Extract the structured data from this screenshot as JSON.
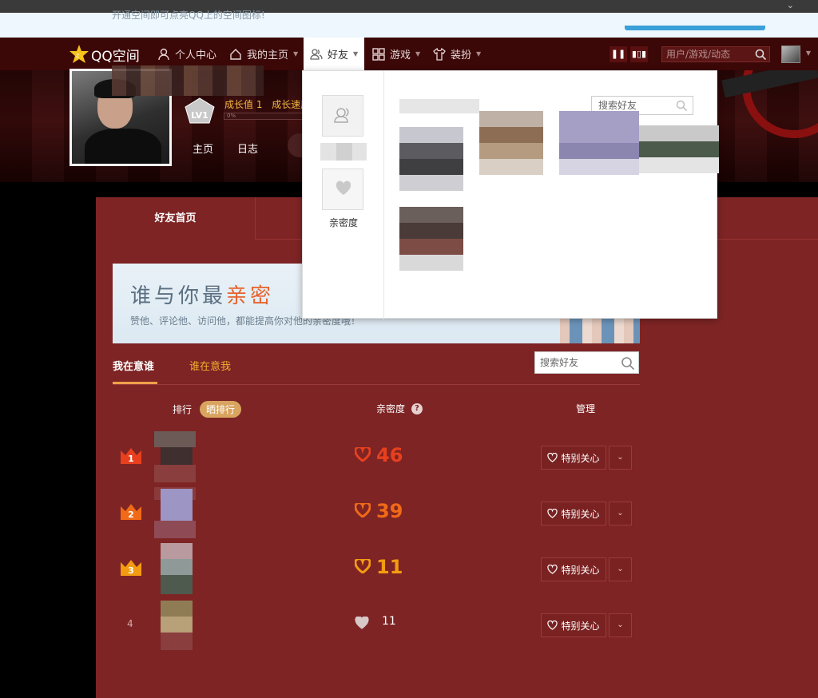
{
  "notice": {
    "text": "开通空间即可点亮QQ上的空间图标!"
  },
  "nav": {
    "logo": "QQ空间",
    "items": [
      {
        "label": "个人中心"
      },
      {
        "label": "我的主页"
      },
      {
        "label": "好友"
      },
      {
        "label": "游戏"
      },
      {
        "label": "装扮"
      }
    ],
    "search_placeholder": "用户/游戏/动态"
  },
  "profile": {
    "level": "LV1",
    "growth_value": "成长值 1",
    "growth_speed": "成长速度",
    "progress": "0%",
    "tabs": [
      "主页",
      "日志"
    ]
  },
  "panel": {
    "home_tab": "好友首页",
    "banner_title_plain": "谁与你最",
    "banner_title_accent": "亲密",
    "banner_subtitle": "赞他、评论他、访问他，都能提高你对他的亲密度哦！",
    "subtabs": [
      "我在意谁",
      "谁在意我"
    ],
    "search_placeholder": "搜索好友",
    "columns": {
      "rank": "排行",
      "share_rank": "晒排行",
      "intimacy": "亲密度",
      "help": "?",
      "manage": "管理"
    },
    "rows": [
      {
        "rank": "1",
        "score": "46",
        "care": "特别关心",
        "color": "#e8401e"
      },
      {
        "rank": "2",
        "score": "39",
        "care": "特别关心",
        "color": "#f06a18"
      },
      {
        "rank": "3",
        "score": "11",
        "care": "特别关心",
        "color": "#f39c12"
      },
      {
        "rank": "4",
        "score": "11",
        "care": "特别关心",
        "color": "#cccccc"
      }
    ]
  },
  "popover": {
    "side_label": "亲密度",
    "search_placeholder": "搜索好友"
  },
  "colors": {
    "accent": "#f0b030",
    "panel_bg": "#7e2424",
    "nav_bg": "#3b0707"
  }
}
